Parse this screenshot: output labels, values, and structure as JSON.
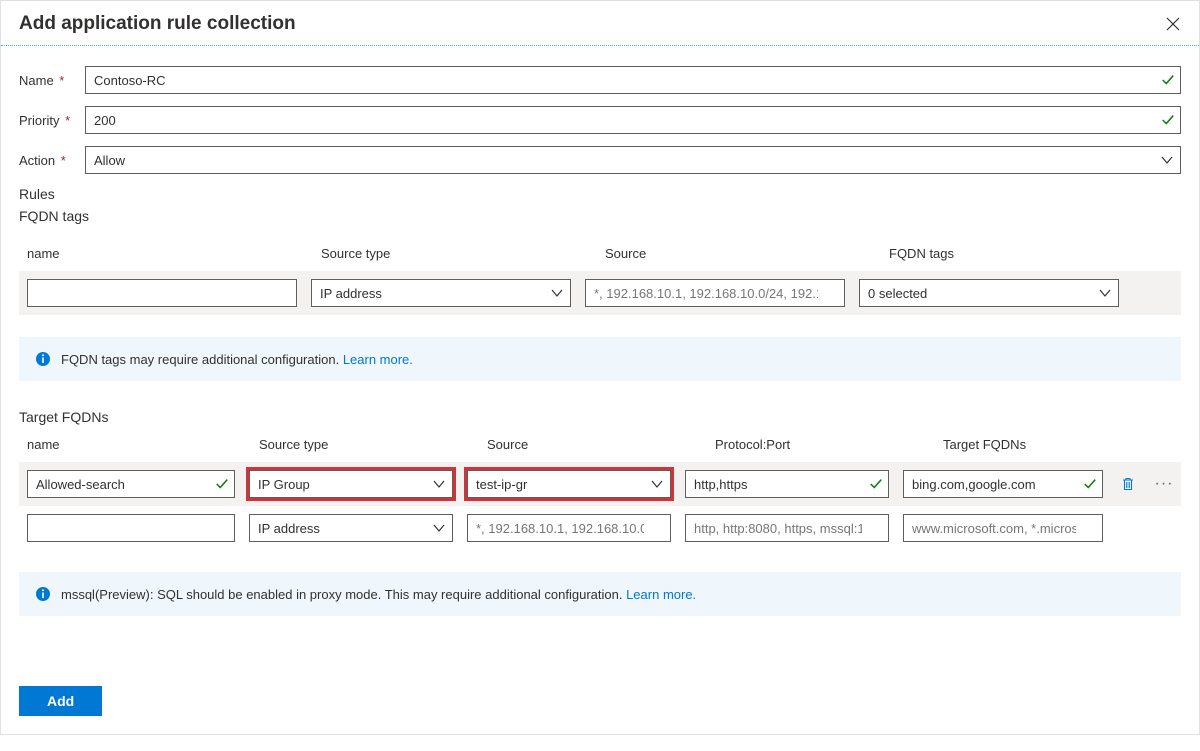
{
  "header": {
    "title": "Add application rule collection"
  },
  "form": {
    "name_label": "Name",
    "name_value": "Contoso-RC",
    "priority_label": "Priority",
    "priority_value": "200",
    "action_label": "Action",
    "action_value": "Allow"
  },
  "rules_section_label": "Rules",
  "fqdn_tags": {
    "section_label": "FQDN tags",
    "columns": {
      "name": "name",
      "source_type": "Source type",
      "source": "Source",
      "fqdn_tags": "FQDN tags"
    },
    "row": {
      "name_value": "",
      "source_type_value": "IP address",
      "source_placeholder": "*, 192.168.10.1, 192.168.10.0/24, 192.1…",
      "fqdn_tags_value": "0 selected"
    },
    "info_text": "FQDN tags may require additional configuration. ",
    "info_link": "Learn more."
  },
  "target_fqdns": {
    "section_label": "Target FQDNs",
    "columns": {
      "name": "name",
      "source_type": "Source type",
      "source": "Source",
      "protocol_port": "Protocol:Port",
      "target_fqdns": "Target FQDNs"
    },
    "rows": [
      {
        "name_value": "Allowed-search",
        "source_type_value": "IP Group",
        "source_value": "test-ip-gr",
        "protocol_value": "http,https",
        "target_value": "bing.com,google.com"
      },
      {
        "name_value": "",
        "source_type_value": "IP address",
        "source_placeholder": "*, 192.168.10.1, 192.168.10.0/…",
        "protocol_placeholder": "http, http:8080, https, mssql:1…",
        "target_placeholder": "www.microsoft.com, *.micros…"
      }
    ],
    "info_text": "mssql(Preview): SQL should be enabled in proxy mode. This may require additional configuration. ",
    "info_link": "Learn more."
  },
  "footer": {
    "add_button": "Add"
  }
}
